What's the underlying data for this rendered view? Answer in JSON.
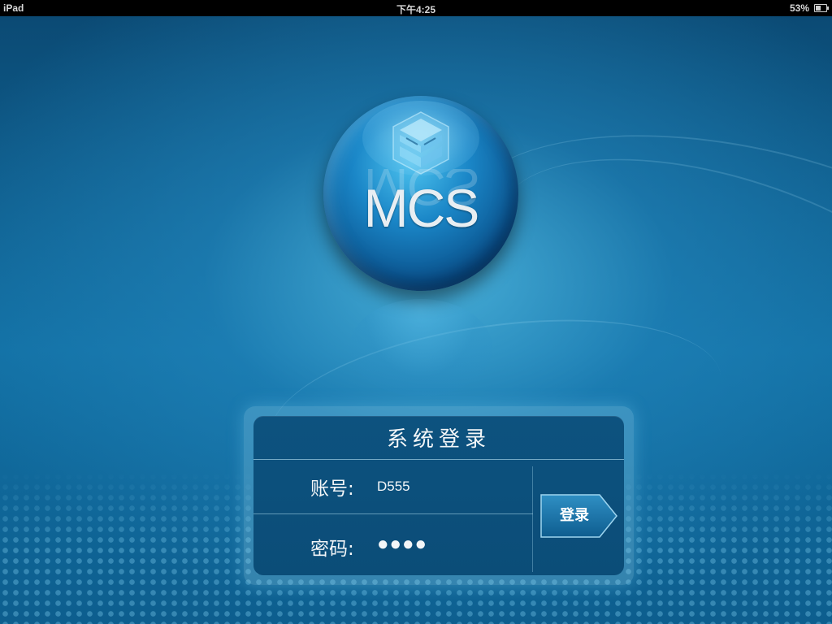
{
  "status_bar": {
    "device": "iPad",
    "time": "下午4:25",
    "battery": "53%",
    "battery_level": 0.53
  },
  "logo": {
    "text": "MCS",
    "icon": "mcs-logo-icon"
  },
  "login": {
    "title": "系统登录",
    "account_label": "账号:",
    "account_value": "D555",
    "password_label": "密码:",
    "password_value": "●●●●",
    "submit_label": "登录"
  },
  "colors": {
    "background": "#0f5f8d",
    "panel": "#0b4d78",
    "accent": "#4cc2ee"
  }
}
